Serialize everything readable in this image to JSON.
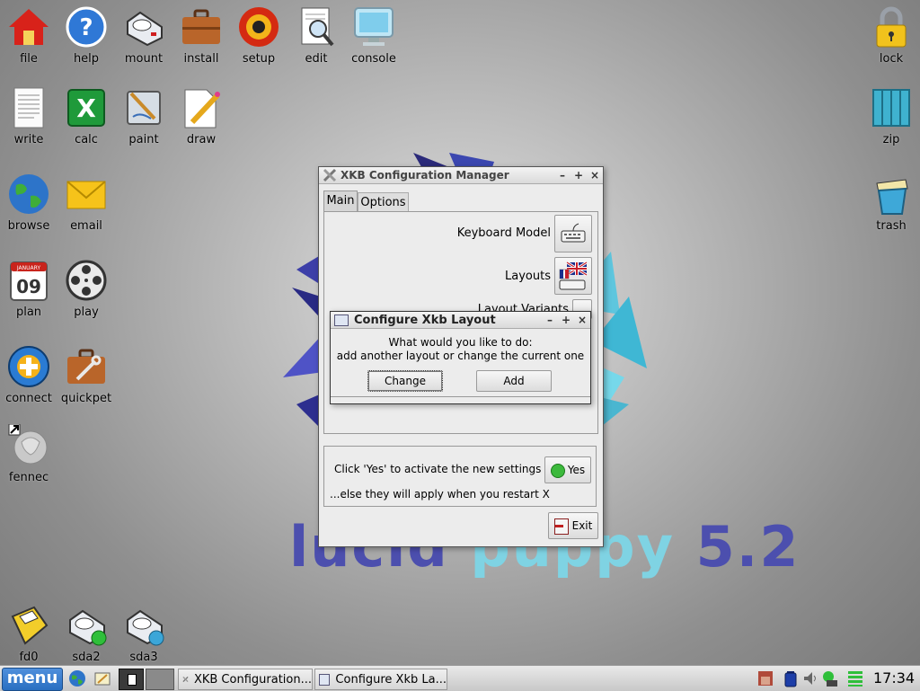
{
  "desktop": {
    "icons": [
      {
        "label": "file",
        "icon": "house-icon"
      },
      {
        "label": "help",
        "icon": "help-icon"
      },
      {
        "label": "mount",
        "icon": "drive-icon"
      },
      {
        "label": "install",
        "icon": "briefcase-icon"
      },
      {
        "label": "setup",
        "icon": "setup-icon"
      },
      {
        "label": "edit",
        "icon": "edit-icon"
      },
      {
        "label": "console",
        "icon": "monitor-icon"
      },
      {
        "label": "lock",
        "icon": "padlock-icon"
      },
      {
        "label": "write",
        "icon": "document-icon"
      },
      {
        "label": "calc",
        "icon": "spreadsheet-icon"
      },
      {
        "label": "paint",
        "icon": "paint-icon"
      },
      {
        "label": "draw",
        "icon": "pencil-icon"
      },
      {
        "label": "zip",
        "icon": "archive-icon"
      },
      {
        "label": "browse",
        "icon": "globe-icon"
      },
      {
        "label": "email",
        "icon": "envelope-icon"
      },
      {
        "label": "trash",
        "icon": "trash-icon"
      },
      {
        "label": "plan",
        "icon": "calendar-icon"
      },
      {
        "label": "play",
        "icon": "film-reel-icon"
      },
      {
        "label": "connect",
        "icon": "connect-icon"
      },
      {
        "label": "quickpet",
        "icon": "toolbox-icon"
      },
      {
        "label": "fennec",
        "icon": "fennec-icon"
      },
      {
        "label": "fd0",
        "icon": "floppy-icon"
      },
      {
        "label": "sda2",
        "icon": "drive-mounted-icon"
      },
      {
        "label": "sda3",
        "icon": "drive-icon"
      }
    ],
    "calendar_month": "JANUARY",
    "calendar_day": "09"
  },
  "wallpaper": {
    "w1": "lucid",
    "w2": "puppy",
    "w3": "5.2"
  },
  "xkb_window": {
    "title": "XKB Configuration Manager",
    "tabs": [
      "Main",
      "Options"
    ],
    "keyboard_model_label": "Keyboard Model",
    "layouts_label": "Layouts",
    "layout_variants_label": "Layout Variants",
    "activate_text": "Click 'Yes' to activate the new settings",
    "yes_label": "Yes",
    "else_text": "...else they will apply when you restart X",
    "exit_label": "Exit",
    "controls": [
      "–",
      "+",
      "×"
    ]
  },
  "dialog": {
    "title": "Configure Xkb Layout",
    "line1": "What would you like to do:",
    "line2": "add another layout or change the current one",
    "change_label": "Change",
    "add_label": "Add"
  },
  "taskbar": {
    "menu_label": "menu",
    "tasks": [
      "XKB Configuration...",
      "Configure Xkb La..."
    ],
    "clock": "17:34"
  },
  "colors": {
    "accent": "#2a6fc1",
    "yes_green": "#3cb93c"
  }
}
